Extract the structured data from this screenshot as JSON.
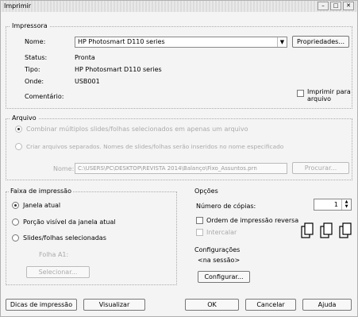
{
  "window": {
    "title": "Imprimir",
    "min": "–",
    "max": "□",
    "close": "✕"
  },
  "printer": {
    "group_label": "Impressora",
    "name_label": "Nome:",
    "name_value": "HP Photosmart D110 series",
    "properties_button": "Propriedades...",
    "status_label": "Status:",
    "status_value": "Pronta",
    "type_label": "Tipo:",
    "type_value": "HP Photosmart D110 series",
    "where_label": "Onde:",
    "where_value": "USB001",
    "comment_label": "Comentário:",
    "print_to_file": "Imprimir para arquivo"
  },
  "file": {
    "group_label": "Arquivo",
    "combine_option": "Combinar múltiplos slides/folhas selecionados em apenas um arquivo",
    "separate_option": "Criar arquivos separados. Nomes de slides/folhas serão inseridos no nome especificado",
    "name_label": "Nome:",
    "name_value": "C:\\USERS\\PC\\DESKTOP\\REVISTA 2014\\Balanço\\Fixo_Assuntos.prn",
    "browse_button": "Procurar..."
  },
  "range": {
    "group_label": "Faixa de impressão",
    "current_window": "Janela atual",
    "visible_portion": "Porção visível da janela atual",
    "selected_sheets": "Slides/folhas selecionadas",
    "sheet_text": "Folha A1:",
    "select_button": "Selecionar..."
  },
  "options": {
    "group_label": "Opções",
    "copies_label": "Número de cópias:",
    "copies_value": "1",
    "reverse_order": "Ordem de impressão reversa",
    "collate": "Intercalar"
  },
  "settings": {
    "group_label": "Configurações",
    "value": "<na sessão>",
    "configure_button": "Configurar..."
  },
  "footer": {
    "tips_button": "Dicas de impressão",
    "preview_button": "Visualizar",
    "ok_button": "OK",
    "cancel_button": "Cancelar",
    "help_button": "Ajuda"
  }
}
